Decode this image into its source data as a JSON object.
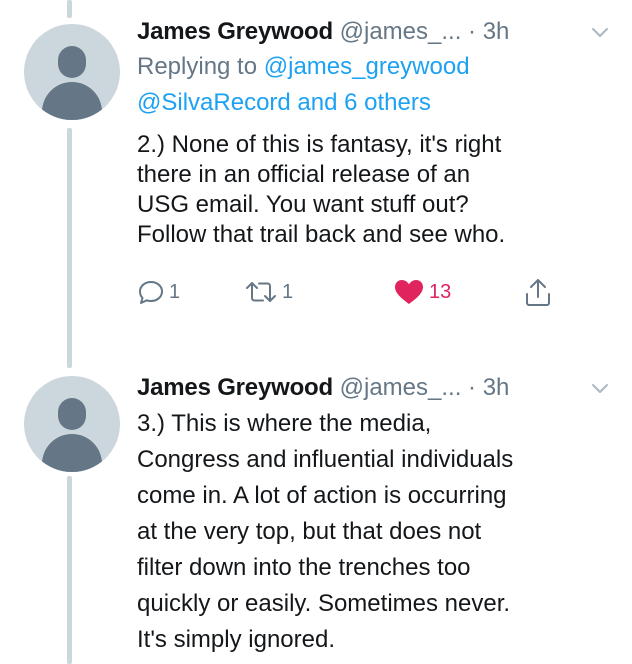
{
  "tweets": [
    {
      "name": "James Greywood",
      "handle": "@james_...",
      "dot": "·",
      "time": "3h",
      "replying_prefix": "Replying to ",
      "replying_to": "@james_greywood",
      "replying_line2": "@SilvaRecord and 6 others",
      "text": "2.) None of this is fantasy, it's right\nthere in an official release of an\nUSG email. You want stuff out?\nFollow that trail back and see who.",
      "reply_count": "1",
      "retweet_count": "1",
      "like_count": "13",
      "liked": true
    },
    {
      "name": "James Greywood",
      "handle": "@james_...",
      "dot": "·",
      "time": "3h",
      "text": "3.) This is where the media,\nCongress and influential individuals\ncome in. A lot of action is occurring\nat the very top, but that does not\nfilter down into the trenches too\nquickly or easily. Sometimes never.\nIt's simply ignored."
    }
  ],
  "colors": {
    "link": "#1da1f2",
    "muted": "#657786",
    "like": "#e0245e",
    "avatar_bg": "#ccd6dd",
    "avatar_fg": "#657786"
  },
  "icons": {
    "reply": "reply-icon",
    "retweet": "retweet-icon",
    "like": "heart-icon",
    "share": "share-icon",
    "menu": "chevron-down-icon"
  }
}
